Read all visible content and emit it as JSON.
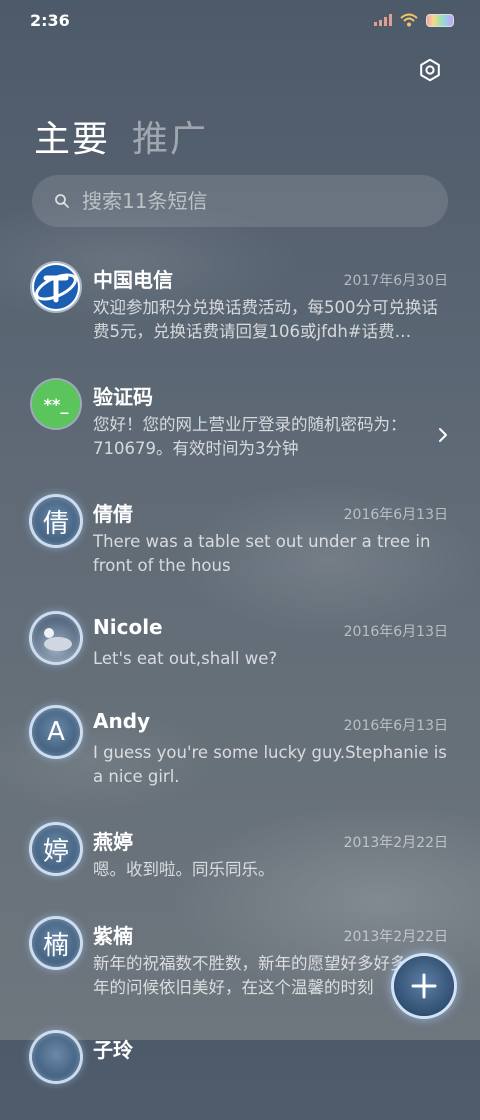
{
  "status_bar": {
    "time": "2:36"
  },
  "tabs": [
    {
      "label": "主要"
    },
    {
      "label": "推广"
    }
  ],
  "search": {
    "placeholder": "搜索11条短信"
  },
  "conversations": [
    {
      "name": "中国电信",
      "date": "2017年6月30日",
      "preview": "欢迎参加积分兑换话费活动，每500分可兑换话费5元，兑换话费请回复106或jfdh#话费…",
      "avatar": "telecom-logo"
    },
    {
      "name": "验证码",
      "date": "",
      "preview": "您好！您的网上营业厅登录的随机密码为：710679。有效时间为3分钟",
      "avatar_text": "**_",
      "avatar": "verification-code"
    },
    {
      "name": "倩倩",
      "date": "2016年6月13日",
      "preview": "There was a table set out under a tree in front of the hous",
      "avatar_text": "倩"
    },
    {
      "name": "Nicole",
      "date": "2016年6月13日",
      "preview": "Let's eat out,shall we?",
      "avatar": "photo"
    },
    {
      "name": "Andy",
      "date": "2016年6月13日",
      "preview": "I guess you're some lucky guy.Stephanie is a nice girl.",
      "avatar_text": "A"
    },
    {
      "name": "燕婷",
      "date": "2013年2月22日",
      "preview": "嗯。收到啦。同乐同乐。",
      "avatar_text": "婷"
    },
    {
      "name": "紫楠",
      "date": "2013年2月22日",
      "preview": "新年的祝福数不胜数，新年的愿望好多好多，新年的问候依旧美好，在这个温馨的时刻",
      "avatar_text": "楠"
    },
    {
      "name": "子玲",
      "date": "",
      "preview": "",
      "avatar_text": ""
    }
  ],
  "colors": {
    "accent_verify": "#5cc45c",
    "telecom_blue": "#1a5fb4"
  },
  "icons": {
    "settings": "gear-icon",
    "search": "search-icon",
    "compose": "plus-icon",
    "chevron": "chevron-right-icon"
  }
}
